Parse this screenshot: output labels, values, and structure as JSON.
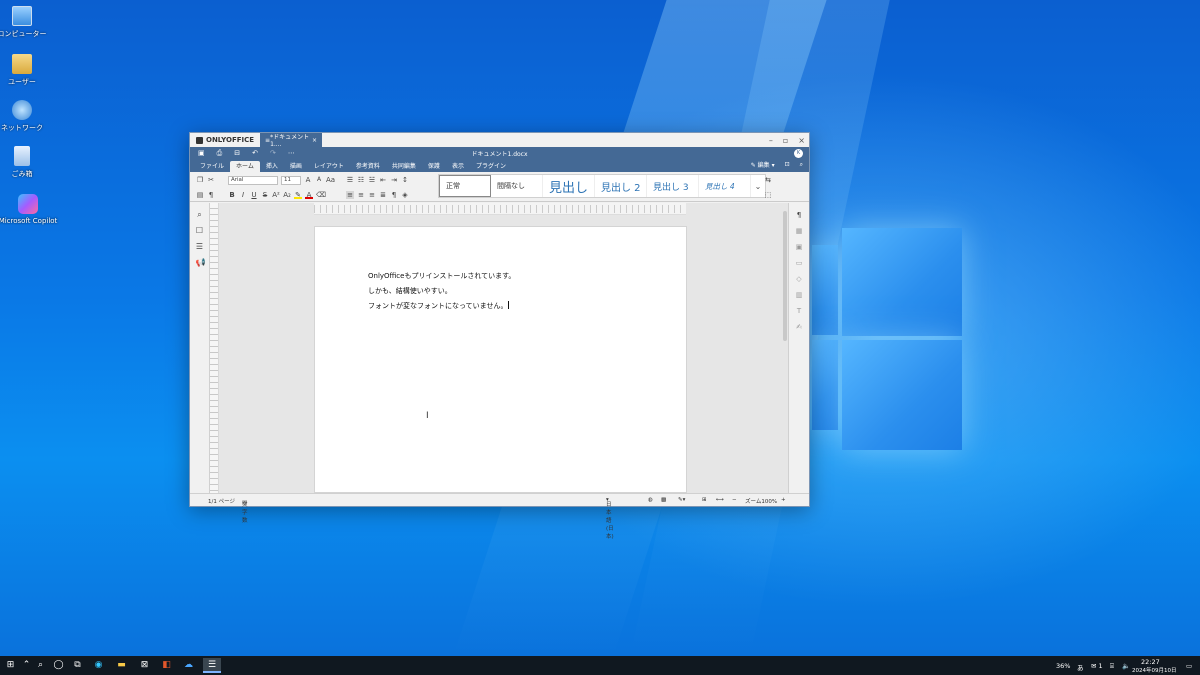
{
  "desktop": {
    "icons": [
      {
        "label": "コンピューター",
        "icon": "computer-icon"
      },
      {
        "label": "ユーザー",
        "icon": "user-folder-icon"
      },
      {
        "label": "ネットワーク",
        "icon": "network-icon"
      },
      {
        "label": "ごみ箱",
        "icon": "recycle-bin-icon"
      },
      {
        "label": "Microsoft Copilot",
        "icon": "copilot-icon"
      }
    ]
  },
  "window": {
    "brand": "ONLYOFFICE",
    "tab_title": "*ドキュメント1....",
    "tab_close": "×",
    "doc_title": "ドキュメント1.docx",
    "avatar": "K",
    "controls": {
      "minimize": "–",
      "restore": "▫",
      "close": "×"
    },
    "menu": [
      {
        "label": "ファイル",
        "active": false
      },
      {
        "label": "ホーム",
        "active": true
      },
      {
        "label": "挿入",
        "active": false
      },
      {
        "label": "描画",
        "active": false
      },
      {
        "label": "レイアウト",
        "active": false
      },
      {
        "label": "参考資料",
        "active": false
      },
      {
        "label": "共同編集",
        "active": false
      },
      {
        "label": "保護",
        "active": false
      },
      {
        "label": "表示",
        "active": false
      },
      {
        "label": "プラグイン",
        "active": false
      }
    ],
    "edit_mode": "編集",
    "font_name": "Arial",
    "font_size": "11",
    "styles": [
      {
        "label": "正常",
        "size": "7px",
        "color": "#333333",
        "selected": true
      },
      {
        "label": "間隔なし",
        "size": "7px",
        "color": "#333333",
        "selected": false
      },
      {
        "label": "見出し",
        "size": "13px",
        "color": "#2e74b5",
        "selected": false
      },
      {
        "label": "見出し 2",
        "size": "10px",
        "color": "#2e74b5",
        "selected": false
      },
      {
        "label": "見出し 3",
        "size": "9px",
        "color": "#2e74b5",
        "selected": false
      },
      {
        "label": "見出し 4",
        "size": "7.5px",
        "color": "#2e74b5",
        "selected": false
      }
    ],
    "document_lines": [
      "OnlyOfficeもプリインストールされています。",
      "しかも、結構使いやすい。",
      "フォントが変なフォントになっていません。"
    ],
    "status": {
      "page": "1/1 ページ",
      "word_count": "文字数",
      "language": "日本語 (日本)",
      "zoom": "ズーム100%",
      "zoom_out": "−",
      "zoom_in": "+"
    }
  },
  "taskbar": {
    "battery": "36%",
    "ime": "あ",
    "notifications": "1",
    "time": "22:27",
    "date": "2024年09月10日"
  },
  "colors": {
    "accent": "#446995",
    "desktop": "#0a78e6"
  }
}
